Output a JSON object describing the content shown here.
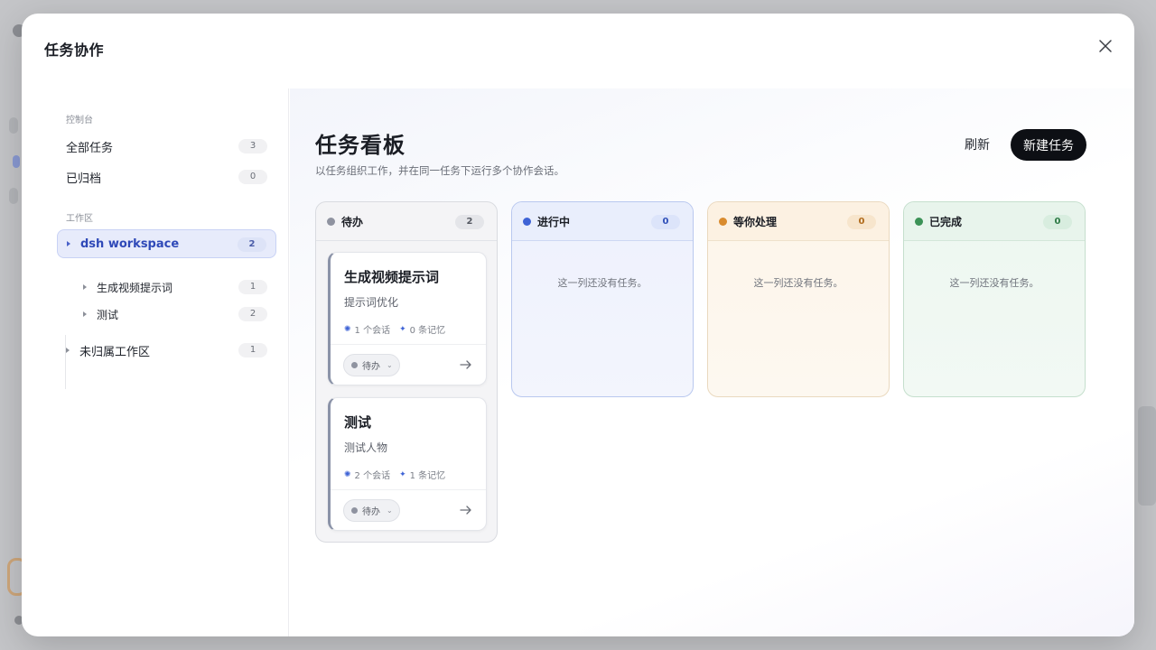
{
  "modal": {
    "title": "任务协作"
  },
  "sidebar": {
    "console_label": "控制台",
    "console_items": [
      {
        "label": "全部任务",
        "count": "3"
      },
      {
        "label": "已归档",
        "count": "0"
      }
    ],
    "workspace_label": "工作区",
    "workspaces": [
      {
        "label": "dsh workspace",
        "count": "2",
        "active": true,
        "children": [
          {
            "label": "生成视频提示词",
            "count": "1"
          },
          {
            "label": "测试",
            "count": "2"
          }
        ]
      },
      {
        "label": "未归属工作区",
        "count": "1"
      }
    ]
  },
  "board": {
    "title": "任务看板",
    "subtitle": "以任务组织工作，并在同一任务下运行多个协作会话。",
    "refresh_label": "刷新",
    "new_task_label": "新建任务",
    "empty_text": "这一列还没有任务。",
    "columns": [
      {
        "label": "待办",
        "count": "2",
        "color": "#8f93a0"
      },
      {
        "label": "进行中",
        "count": "0",
        "color": "#3e63d6"
      },
      {
        "label": "等你处理",
        "count": "0",
        "color": "#d98b2e"
      },
      {
        "label": "已完成",
        "count": "0",
        "color": "#3c9257"
      }
    ],
    "cards": [
      {
        "title": "生成视频提示词",
        "desc": "提示词优化",
        "sessions": "1 个会话",
        "memories": "0 条记忆",
        "status": "待办"
      },
      {
        "title": "测试",
        "desc": "测试人物",
        "sessions": "2 个会话",
        "memories": "1 条记忆",
        "status": "待办"
      }
    ]
  }
}
